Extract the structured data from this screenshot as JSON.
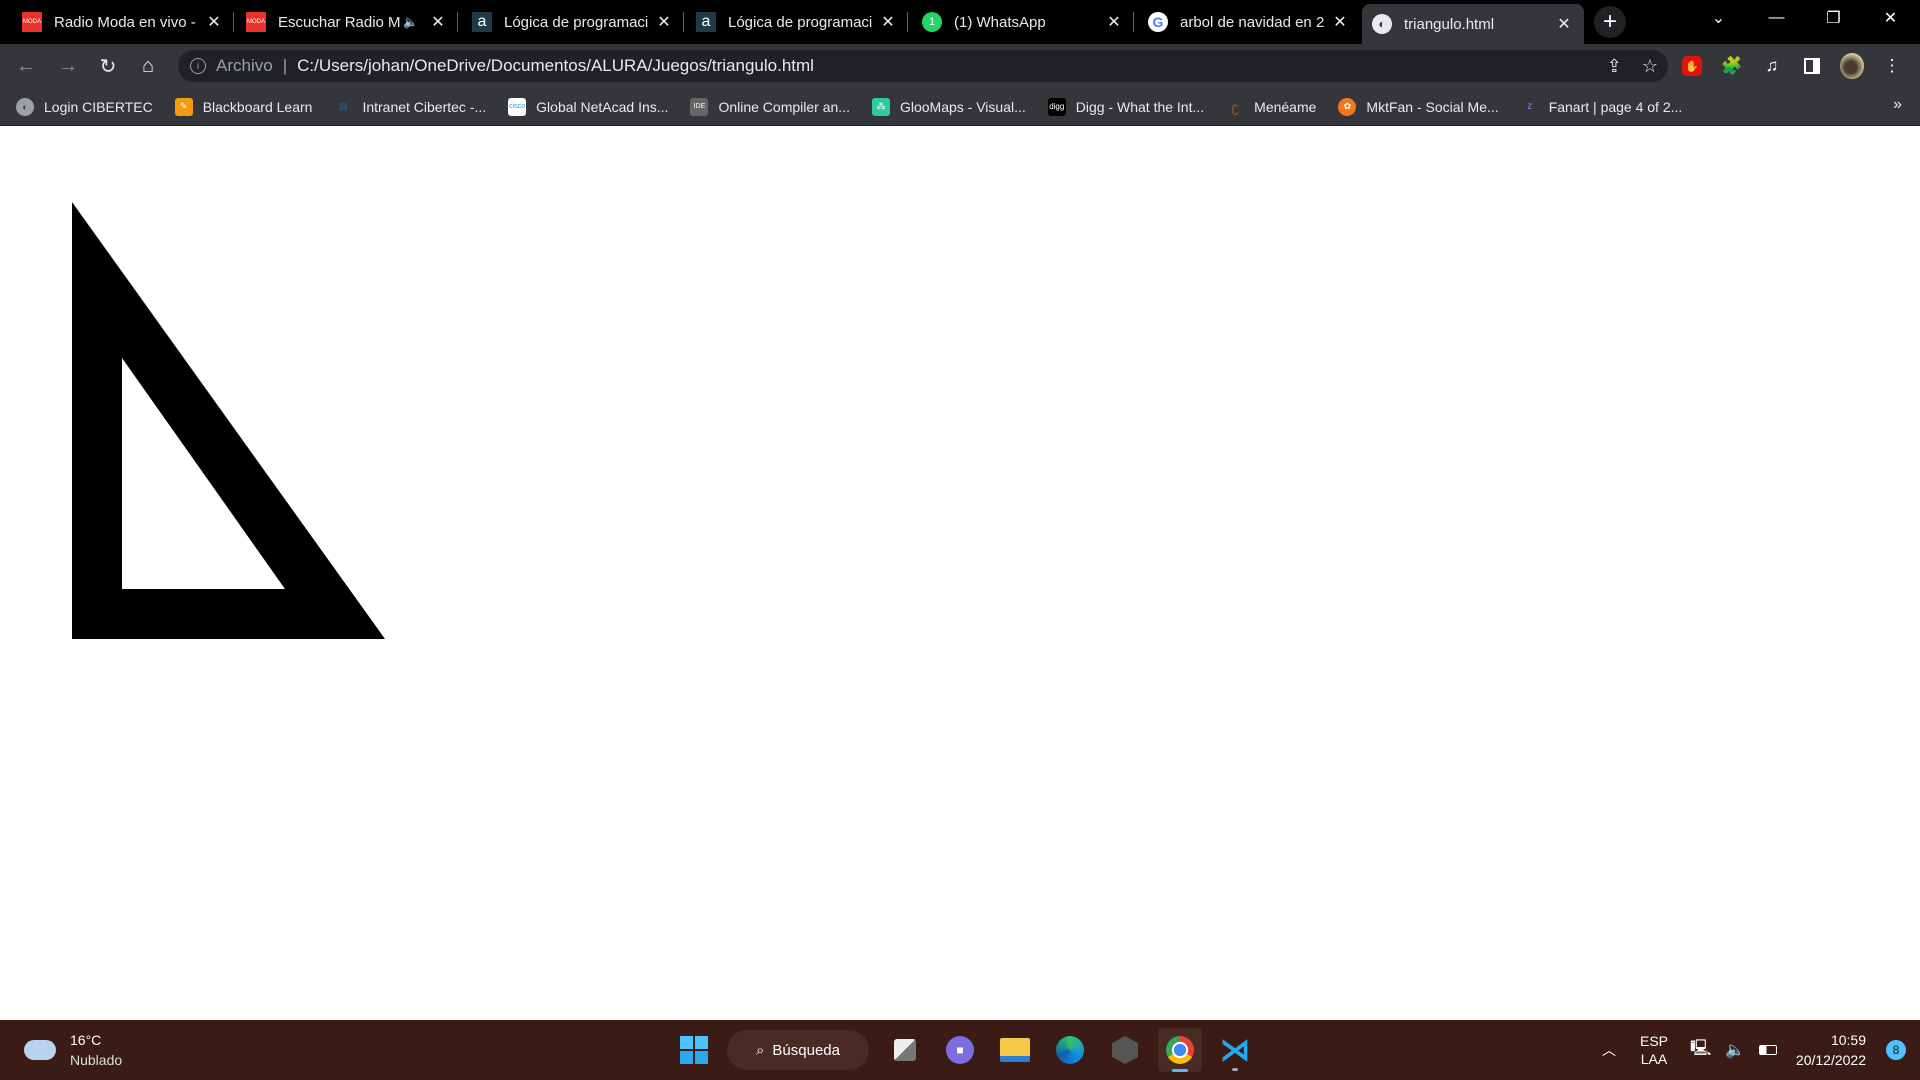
{
  "browser": {
    "tabs": [
      {
        "title": "Radio Moda en vivo -",
        "icon": "radio-moda-icon",
        "active": false,
        "muted_icon": false
      },
      {
        "title": "Escuchar Radio M",
        "icon": "radio-moda-icon",
        "active": false,
        "muted_icon": true
      },
      {
        "title": "Lógica de programaci",
        "icon": "alura-icon",
        "active": false,
        "muted_icon": false
      },
      {
        "title": "Lógica de programaci",
        "icon": "alura-icon",
        "active": false,
        "muted_icon": false
      },
      {
        "title": "(1) WhatsApp",
        "icon": "whatsapp-icon",
        "active": false,
        "muted_icon": false,
        "badge": "1"
      },
      {
        "title": "arbol de navidad en 2",
        "icon": "google-icon",
        "active": false,
        "muted_icon": false
      },
      {
        "title": "triangulo.html",
        "icon": "globe-icon",
        "active": true,
        "muted_icon": false
      }
    ],
    "new_tab_label": "+",
    "address": {
      "scheme_label": "Archivo",
      "url": "C:/Users/johan/OneDrive/Documentos/ALURA/Juegos/triangulo.html"
    },
    "bookmarks": [
      {
        "label": "Login CIBERTEC",
        "icon": "globe-icon"
      },
      {
        "label": "Blackboard Learn",
        "icon": "blackboard-icon"
      },
      {
        "label": "Intranet Cibertec -...",
        "icon": "cibertec-icon"
      },
      {
        "label": "Global NetAcad Ins...",
        "icon": "cisco-icon"
      },
      {
        "label": "Online Compiler an...",
        "icon": "ideone-icon"
      },
      {
        "label": "GlooMaps - Visual...",
        "icon": "gloomaps-icon"
      },
      {
        "label": "Digg - What the Int...",
        "icon": "digg-icon"
      },
      {
        "label": "Menéame",
        "icon": "meneame-icon"
      },
      {
        "label": "MktFan - Social Me...",
        "icon": "mktfan-icon"
      },
      {
        "label": "Fanart | page 4 of 2...",
        "icon": "fanart-icon"
      }
    ],
    "bookmarks_overflow": "»"
  },
  "page": {
    "shape": "triangle-outline",
    "fill_color": "#000000",
    "background": "#ffffff"
  },
  "taskbar": {
    "weather": {
      "temp": "16°C",
      "condition": "Nublado"
    },
    "search_label": "Búsqueda",
    "apps": [
      "task-view",
      "teams-chat",
      "file-explorer",
      "edge",
      "unity-hub",
      "chrome",
      "vscode"
    ],
    "lang": {
      "line1": "ESP",
      "line2": "LAA"
    },
    "time": "10:59",
    "date": "20/12/2022",
    "notifications": "8"
  }
}
